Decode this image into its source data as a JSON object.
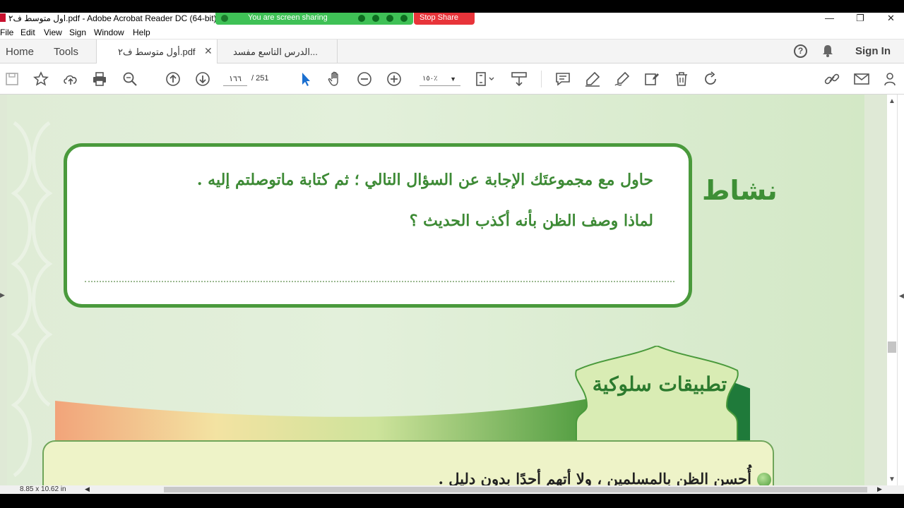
{
  "titlebar": {
    "title": "اول متوسط ف٢.pdf - Adobe Acrobat Reader DC (64-bit)",
    "sharing_label": "You are screen sharing",
    "stop_share_label": "Stop Share",
    "minimize": "—",
    "restore": "❐",
    "close": "✕"
  },
  "menu": [
    "File",
    "Edit",
    "View",
    "Sign",
    "Window",
    "Help"
  ],
  "tabs": {
    "home": "Home",
    "tools": "Tools",
    "documents": [
      {
        "label": "أول متوسط ف٢.pdf",
        "active": true,
        "close": "✕"
      },
      {
        "label": "الدرس التاسع مفسد...",
        "active": false
      }
    ],
    "help": "?",
    "sign_in": "Sign In"
  },
  "toolbar": {
    "current_page": "١٦٦",
    "page_sep_total": "/  251",
    "zoom": "١٥٠٪"
  },
  "document": {
    "activity_label": "نشاط",
    "activity_line1": "حاول مع مجموعتَك الإجابة عن السؤال التالي ؛ ثم كتابة ماتوصلتم إليه .",
    "activity_line2": "لماذا وصف الظن بأنه أكذب الحديث ؟",
    "section_title": "تطبيقات سلوكية",
    "application_line": "أُحسن الظن بالمسلمين ، ولا أتهم أحدًا بدون دليل ."
  },
  "status": {
    "page_size": "8.85 x 10.62 in"
  },
  "colors": {
    "accent_green": "#3d8a35",
    "share_green": "#3fc156",
    "stop_red": "#e8343a"
  }
}
